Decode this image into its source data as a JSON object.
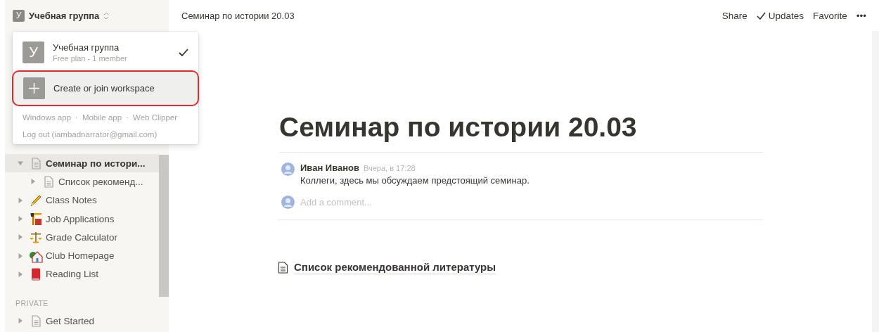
{
  "workspace": {
    "initial": "У",
    "name": "Учебная группа"
  },
  "breadcrumb": "Семинар по истории 20.03",
  "actions": [
    {
      "kind": "text",
      "label": "Share"
    },
    {
      "kind": "check",
      "label": "Updates"
    },
    {
      "kind": "text",
      "label": "Favorite"
    },
    {
      "kind": "text",
      "label": "•••"
    }
  ],
  "workspace_menu": {
    "workspaces": [
      {
        "initial": "У",
        "name": "Учебная группа",
        "plan": "Free plan - 1 member",
        "selected": true
      }
    ],
    "create": {
      "label": "Create or join workspace",
      "highlighted": true
    },
    "links": [
      "Windows app",
      "Mobile app",
      "Web Clipper"
    ],
    "separator": "·",
    "logout": "Log out (iambadnarrator@gmail.com)"
  },
  "sidebar": {
    "pages": [
      {
        "title": "Семинар по истори...",
        "kind": "page",
        "expanded": true,
        "selected": true,
        "children": [
          {
            "title": "Список рекоменд...",
            "kind": "page",
            "expanded": false,
            "selected": false
          }
        ]
      },
      {
        "title": "Class Notes",
        "kind": "pencil",
        "expanded": false,
        "selected": false
      },
      {
        "title": "Job Applications",
        "kind": "crane",
        "expanded": false,
        "selected": false
      },
      {
        "title": "Grade Calculator",
        "kind": "scales",
        "expanded": false,
        "selected": false
      },
      {
        "title": "Club Homepage",
        "kind": "house",
        "expanded": false,
        "selected": false
      },
      {
        "title": "Reading List",
        "kind": "book",
        "expanded": false,
        "selected": false
      }
    ],
    "private_label": "PRIVATE",
    "private_pages": [
      {
        "title": "Get Started",
        "kind": "page",
        "expanded": false,
        "selected": false
      }
    ]
  },
  "page": {
    "title": "Семинар по истории 20.03",
    "comments": [
      {
        "author": "Иван Иванов",
        "time": "Вчера, в 17:28",
        "text": "Коллеги, здесь мы обсуждаем предстоящий семинар."
      }
    ],
    "comment_placeholder": "Add a comment...",
    "subpages": [
      {
        "title": "Список рекомендованной литературы"
      }
    ]
  }
}
